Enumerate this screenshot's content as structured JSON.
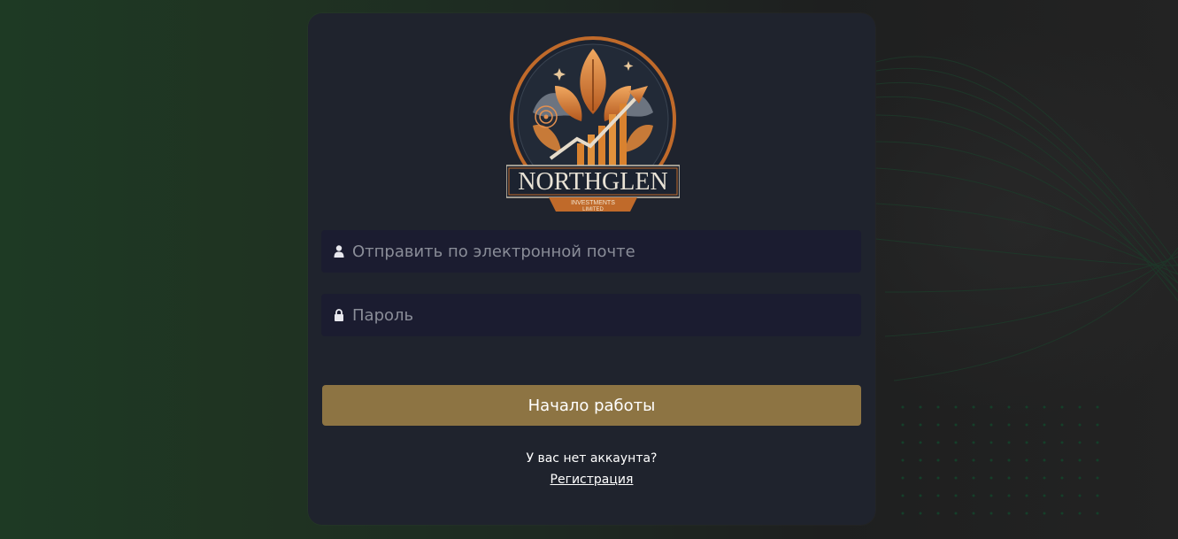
{
  "logo": {
    "brand": "NORTHGLEN",
    "tagline_1": "INVESTMENTS",
    "tagline_2": "LIMITED"
  },
  "form": {
    "email_placeholder": "Отправить по электронной почте",
    "email_value": "",
    "password_placeholder": "Пароль",
    "password_value": "",
    "submit_label": "Начало работы"
  },
  "footer": {
    "no_account_text": "У вас нет аккаунта?",
    "register_label": "Регистрация"
  },
  "colors": {
    "accent": "#8d7443",
    "card_bg": "#1f232d",
    "input_bg": "#1b1c30"
  },
  "icons": {
    "email": "user-icon",
    "password": "lock-icon"
  }
}
